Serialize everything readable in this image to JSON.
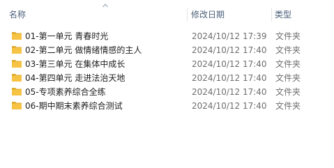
{
  "columns": {
    "name": "名称",
    "date": "修改日期",
    "type": "类型"
  },
  "sort_icon": "sort-ascending-icon",
  "colors": {
    "header_text": "#4c607a",
    "folder_yellow": "#f6c344",
    "folder_dark": "#dca92a",
    "secondary_text": "#6d6d6d"
  },
  "rows": [
    {
      "name": "01-第一单元   青春时光",
      "date": "2024/10/12 17:39",
      "type": "文件夹",
      "icon": "folder-icon"
    },
    {
      "name": "02-第二单元   做情绪情感的主人",
      "date": "2024/10/12 17:40",
      "type": "文件夹",
      "icon": "folder-icon"
    },
    {
      "name": "03-第三单元   在集体中成长",
      "date": "2024/10/12 17:40",
      "type": "文件夹",
      "icon": "folder-icon"
    },
    {
      "name": "04-第四单元   走进法治天地",
      "date": "2024/10/12 17:40",
      "type": "文件夹",
      "icon": "folder-icon"
    },
    {
      "name": "05-专项素养综合全练",
      "date": "2024/10/12 17:40",
      "type": "文件夹",
      "icon": "folder-icon"
    },
    {
      "name": "06-期中期末素养综合测试",
      "date": "2024/10/12 17:40",
      "type": "文件夹",
      "icon": "folder-icon"
    }
  ]
}
